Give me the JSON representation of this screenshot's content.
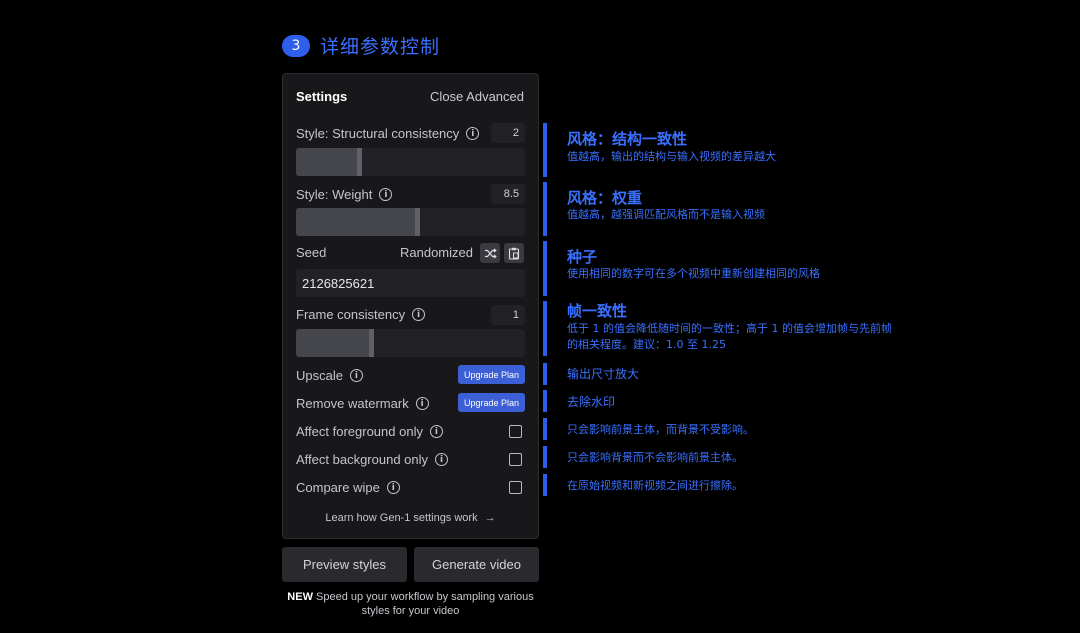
{
  "step": {
    "number": "3",
    "title": "详细参数控制"
  },
  "settings": {
    "title": "Settings",
    "close_advanced": "Close Advanced",
    "structural": {
      "label": "Style: Structural consistency",
      "value": "2",
      "level": 0.29
    },
    "weight": {
      "label": "Style: Weight",
      "value": "8.5",
      "level": 0.54
    },
    "seed": {
      "label": "Seed",
      "randomized_label": "Randomized",
      "value": "2126825621"
    },
    "frame": {
      "label": "Frame consistency",
      "value": "1",
      "level": 0.34
    },
    "upscale": {
      "label": "Upscale",
      "button": "Upgrade Plan"
    },
    "watermark": {
      "label": "Remove watermark",
      "button": "Upgrade Plan"
    },
    "foreground": {
      "label": "Affect foreground only",
      "checked": false
    },
    "background": {
      "label": "Affect background only",
      "checked": false
    },
    "compare": {
      "label": "Compare wipe",
      "checked": false
    },
    "learn_link": "Learn how Gen-1 settings work"
  },
  "buttons": {
    "preview": "Preview styles",
    "generate": "Generate video"
  },
  "promo": {
    "badge": "NEW",
    "line1": "Speed up your workflow by sampling various",
    "line2": "styles for your video"
  },
  "annotations": {
    "structural": {
      "title": "风格：结构一致性",
      "desc": "值越高，输出的结构与输入视频的差异越大"
    },
    "weight": {
      "title": "风格：权重",
      "desc": "值越高，越强调匹配风格而不是输入视频"
    },
    "seed": {
      "title": "种子",
      "desc": "使用相同的数字可在多个视频中重新创建相同的风格"
    },
    "frame": {
      "title": "帧一致性",
      "desc1": "低于 1 的值会降低随时间的一致性；高于 1 的值会增加帧与先前帧",
      "desc2": "的相关程度。建议：1.0 至 1.25"
    },
    "upscale": "输出尺寸放大",
    "watermark": "去除水印",
    "foreground": "只会影响前景主体，而背景不受影响。",
    "background": "只会影响背景而不会影响前景主体。",
    "compare": "在原始视频和新视频之间进行擦除。"
  },
  "colors": {
    "accent": "#2f5fea",
    "annotation_text": "#3a70ff",
    "panel_bg": "#18181b",
    "upgrade_button": "#3d5fd6"
  }
}
